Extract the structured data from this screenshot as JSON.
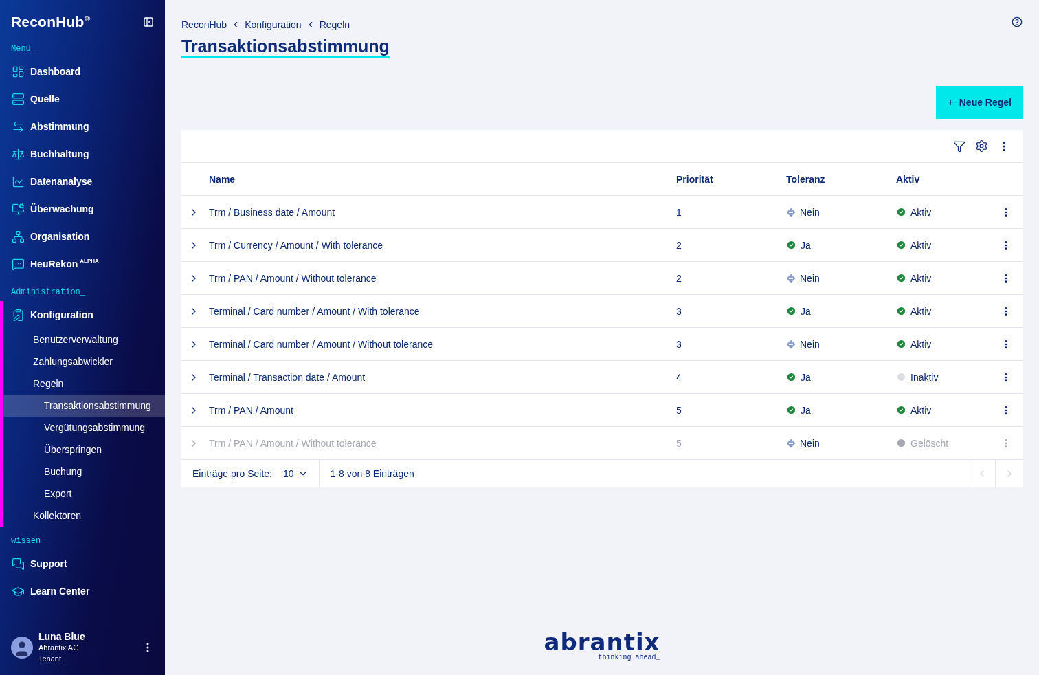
{
  "sidebar": {
    "brand": "ReconHub",
    "brand_mark": "®",
    "sections": [
      {
        "heading": "Menü_",
        "items": [
          {
            "label": "Dashboard",
            "selected": false
          },
          {
            "label": "Quelle",
            "selected": false
          },
          {
            "label": "Abstimmung",
            "selected": false
          },
          {
            "label": "Buchhaltung",
            "selected": false
          },
          {
            "label": "Datenanalyse",
            "selected": false
          },
          {
            "label": "Überwachung",
            "selected": false
          },
          {
            "label": "Organisation",
            "selected": false
          },
          {
            "label": "HeuRekon",
            "badge": "ALPHA",
            "selected": false
          }
        ]
      },
      {
        "heading": "Administration_",
        "items": [
          {
            "label": "Konfiguration",
            "selected": false,
            "expanded": true,
            "children": [
              {
                "label": "Benutzerverwaltung",
                "selected": false
              },
              {
                "label": "Zahlungsabwickler",
                "selected": false
              },
              {
                "label": "Regeln",
                "selected": false,
                "expanded": true,
                "children": [
                  {
                    "label": "Transaktionsabstimmung",
                    "selected": true
                  },
                  {
                    "label": "Vergütungsabstimmung",
                    "selected": false
                  },
                  {
                    "label": "Überspringen",
                    "selected": false
                  },
                  {
                    "label": "Buchung",
                    "selected": false
                  },
                  {
                    "label": "Export",
                    "selected": false
                  }
                ]
              },
              {
                "label": "Kollektoren",
                "selected": false
              }
            ]
          }
        ]
      },
      {
        "heading": "wissen_",
        "items": [
          {
            "label": "Support",
            "selected": false
          },
          {
            "label": "Learn Center",
            "selected": false
          }
        ]
      }
    ],
    "user": {
      "name": "Luna Blue",
      "company": "Abrantix AG",
      "role": "Tenant"
    }
  },
  "breadcrumb": [
    "ReconHub",
    "Konfiguration",
    "Regeln"
  ],
  "title": "Transaktionsabstimmung",
  "new_rule_button": {
    "icon": "+",
    "label": "Neue Regel"
  },
  "table": {
    "columns": [
      "Name",
      "Priorität",
      "Toleranz",
      "Aktiv"
    ],
    "rows": [
      {
        "name": "Trm / Business date / Amount",
        "priority": "1",
        "tolerance": {
          "kind": "no",
          "label": "Nein"
        },
        "status": {
          "kind": "active",
          "label": "Aktiv"
        },
        "disabled": false
      },
      {
        "name": "Trm / Currency / Amount / With tolerance",
        "priority": "2",
        "tolerance": {
          "kind": "yes",
          "label": "Ja"
        },
        "status": {
          "kind": "active",
          "label": "Aktiv"
        },
        "disabled": false
      },
      {
        "name": "Trm / PAN / Amount / Without tolerance",
        "priority": "2",
        "tolerance": {
          "kind": "no",
          "label": "Nein"
        },
        "status": {
          "kind": "active",
          "label": "Aktiv"
        },
        "disabled": false
      },
      {
        "name": "Terminal / Card number / Amount / With tolerance",
        "priority": "3",
        "tolerance": {
          "kind": "yes",
          "label": "Ja"
        },
        "status": {
          "kind": "active",
          "label": "Aktiv"
        },
        "disabled": false
      },
      {
        "name": "Terminal / Card number / Amount / Without tolerance",
        "priority": "3",
        "tolerance": {
          "kind": "no",
          "label": "Nein"
        },
        "status": {
          "kind": "active",
          "label": "Aktiv"
        },
        "disabled": false
      },
      {
        "name": "Terminal / Transaction date / Amount",
        "priority": "4",
        "tolerance": {
          "kind": "yes",
          "label": "Ja"
        },
        "status": {
          "kind": "inactive",
          "label": "Inaktiv"
        },
        "disabled": false
      },
      {
        "name": "Trm / PAN / Amount",
        "priority": "5",
        "tolerance": {
          "kind": "yes",
          "label": "Ja"
        },
        "status": {
          "kind": "active",
          "label": "Aktiv"
        },
        "disabled": false
      },
      {
        "name": "Trm / PAN / Amount / Without tolerance",
        "priority": "5",
        "tolerance": {
          "kind": "no",
          "label": "Nein"
        },
        "status": {
          "kind": "deleted",
          "label": "Gelöscht"
        },
        "disabled": true
      }
    ],
    "pagination": {
      "per_page_label": "Einträge pro Seite:",
      "per_page_value": "10",
      "range": "1-8 von 8 Einträgen",
      "prev_disabled": true,
      "next_disabled": true
    }
  },
  "footer": {
    "logo": "abrantix",
    "tagline": "thinking ahead_"
  }
}
